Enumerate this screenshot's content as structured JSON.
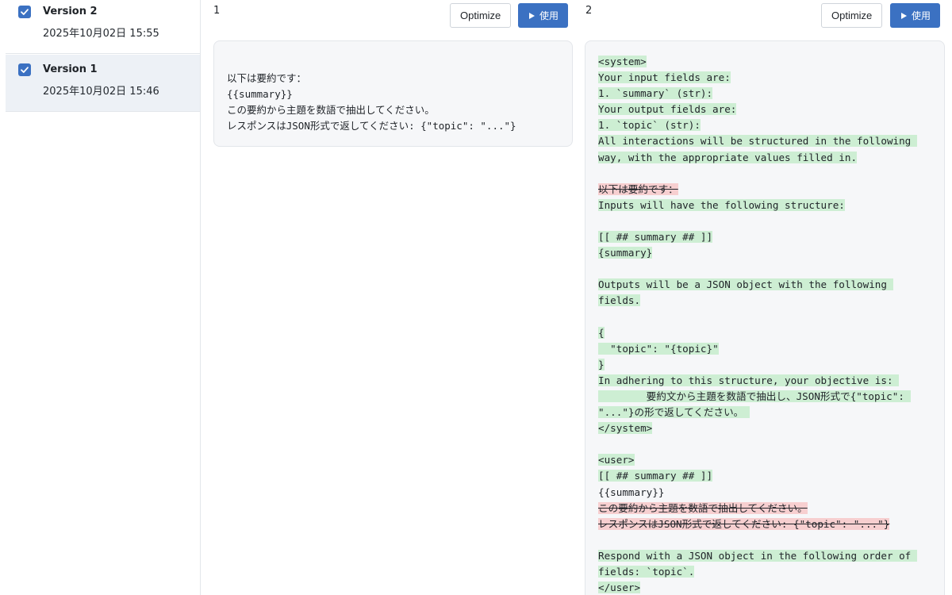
{
  "versions": [
    {
      "name": "Version 2",
      "date": "2025年10月02日 15:55",
      "checked": true
    },
    {
      "name": "Version 1",
      "date": "2025年10月02日 15:46",
      "checked": true
    }
  ],
  "columns": [
    {
      "number": "1",
      "optimize_label": "Optimize",
      "use_label": "使用"
    },
    {
      "number": "2",
      "optimize_label": "Optimize",
      "use_label": "使用"
    }
  ],
  "left_prompt": [
    "以下は要約です：",
    "{{summary}}",
    "この要約から主題を数語で抽出してください。",
    "レスポンスはJSON形式で返してください: {\"topic\": \"...\"}"
  ],
  "diff_lines": [
    {
      "type": "add",
      "text": "<system>"
    },
    {
      "type": "add",
      "text": "Your input fields are:"
    },
    {
      "type": "add",
      "text": "1. `summary` (str):"
    },
    {
      "type": "add",
      "text": "Your output fields are:"
    },
    {
      "type": "add",
      "text": "1. `topic` (str):"
    },
    {
      "type": "add",
      "text": "All interactions will be structured in the following "
    },
    {
      "type": "add",
      "text": "way, with the appropriate values filled in."
    },
    {
      "type": "blank",
      "text": ""
    },
    {
      "type": "del",
      "text": "以下は要約です："
    },
    {
      "type": "add",
      "text": "Inputs will have the following structure:"
    },
    {
      "type": "blank",
      "text": ""
    },
    {
      "type": "add",
      "text": "[[ ## summary ## ]]"
    },
    {
      "type": "add",
      "text": "{summary}"
    },
    {
      "type": "blank",
      "text": ""
    },
    {
      "type": "add",
      "text": "Outputs will be a JSON object with the following "
    },
    {
      "type": "add",
      "text": "fields."
    },
    {
      "type": "blank",
      "text": ""
    },
    {
      "type": "add",
      "text": "{"
    },
    {
      "type": "add",
      "text": "  \"topic\": \"{topic}\""
    },
    {
      "type": "add",
      "text": "}"
    },
    {
      "type": "add",
      "text": "In adhering to this structure, your objective is: "
    },
    {
      "type": "add",
      "text": "        要約文から主題を数語で抽出し、JSON形式で{\"topic\": "
    },
    {
      "type": "add",
      "text": "\"...\"}の形で返してください。 "
    },
    {
      "type": "add",
      "text": "</system>"
    },
    {
      "type": "blank",
      "text": ""
    },
    {
      "type": "add",
      "text": "<user>"
    },
    {
      "type": "add",
      "text": "[[ ## summary ## ]]"
    },
    {
      "type": "ctx",
      "text": "{{summary}}"
    },
    {
      "type": "del",
      "text": "この要約から主題を数語で抽出してください。"
    },
    {
      "type": "del",
      "text": "レスポンスはJSON形式で返してください: {\"topic\": \"...\"}"
    },
    {
      "type": "blank",
      "text": ""
    },
    {
      "type": "add",
      "text": "Respond with a JSON object in the following order of "
    },
    {
      "type": "add",
      "text": "fields: `topic`."
    },
    {
      "type": "add",
      "text": "</user>"
    }
  ],
  "colors": {
    "accent": "#3b71c2",
    "added_bg": "#cdeed3",
    "removed_bg": "#f7cfd0",
    "selected_bg": "#edf1f6"
  }
}
